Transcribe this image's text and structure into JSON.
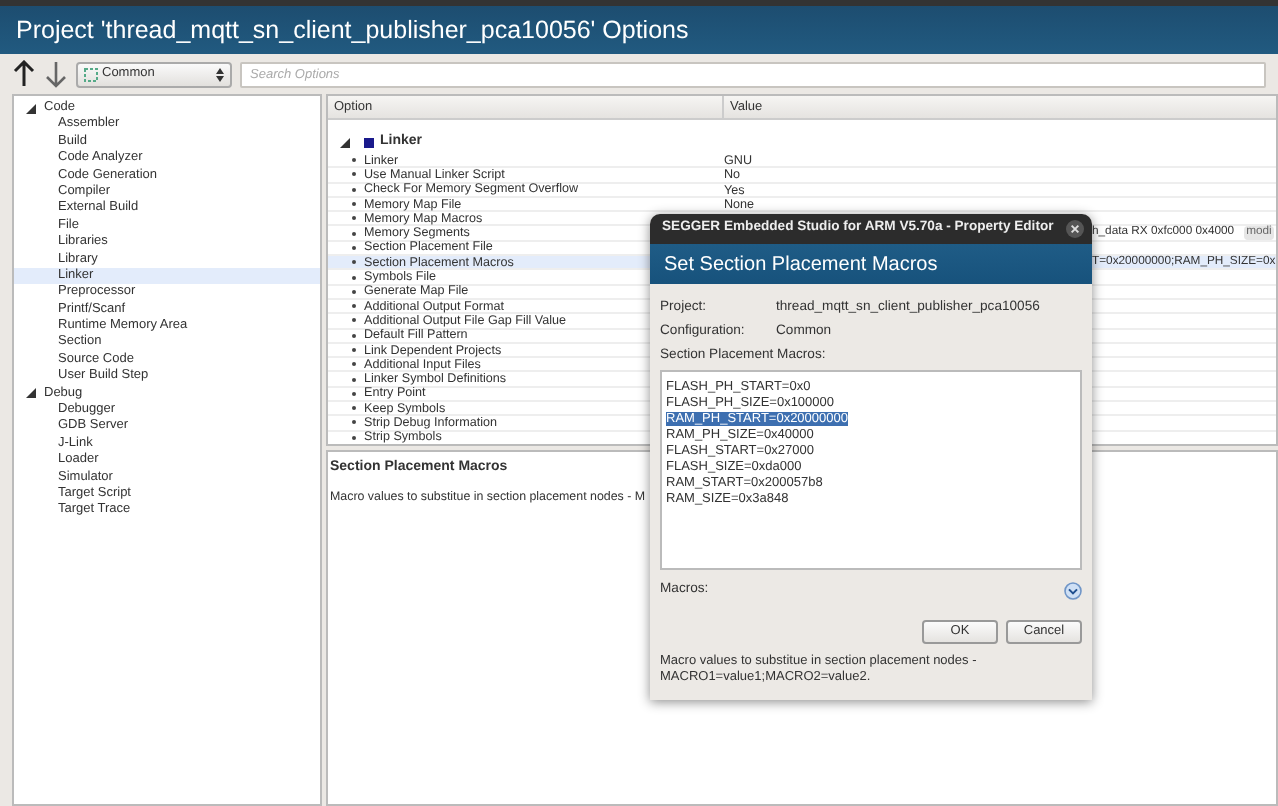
{
  "window": {
    "title": "Project 'thread_mqtt_sn_client_publisher_pca10056' Options"
  },
  "toolbar": {
    "configuration": "Common",
    "search": {
      "placeholder": "Search Options"
    }
  },
  "tree": [
    {
      "label": "Code",
      "expanded": true,
      "children": [
        {
          "label": "Assembler",
          "selected": false
        },
        {
          "label": "Build",
          "selected": false
        },
        {
          "label": "Code Analyzer",
          "selected": false
        },
        {
          "label": "Code Generation",
          "selected": false
        },
        {
          "label": "Compiler",
          "selected": false
        },
        {
          "label": "External Build",
          "selected": false
        },
        {
          "label": "File",
          "selected": false
        },
        {
          "label": "Libraries",
          "selected": false
        },
        {
          "label": "Library",
          "selected": false
        },
        {
          "label": "Linker",
          "selected": true
        },
        {
          "label": "Preprocessor",
          "selected": false
        },
        {
          "label": "Printf/Scanf",
          "selected": false
        },
        {
          "label": "Runtime Memory Area",
          "selected": false
        },
        {
          "label": "Section",
          "selected": false
        },
        {
          "label": "Source Code",
          "selected": false
        },
        {
          "label": "User Build Step",
          "selected": false
        }
      ]
    },
    {
      "label": "Debug",
      "expanded": true,
      "children": [
        {
          "label": "Debugger",
          "selected": false
        },
        {
          "label": "GDB Server",
          "selected": false
        },
        {
          "label": "J-Link",
          "selected": false
        },
        {
          "label": "Loader",
          "selected": false
        },
        {
          "label": "Simulator",
          "selected": false
        },
        {
          "label": "Target Script",
          "selected": false
        },
        {
          "label": "Target Trace",
          "selected": false
        }
      ]
    }
  ],
  "options_table": {
    "columns": [
      "Option",
      "Value"
    ],
    "group": {
      "label": "Linker",
      "expanded": true
    },
    "rows": [
      {
        "option": "Linker",
        "value": "GNU",
        "selected": false
      },
      {
        "option": "Use Manual Linker Script",
        "value": "No",
        "selected": false
      },
      {
        "option": "Check For Memory Segment Overflow",
        "value": "Yes",
        "selected": false
      },
      {
        "option": "Memory Map File",
        "value": "None",
        "selected": false
      },
      {
        "option": "Memory Map Macros",
        "selected": false
      },
      {
        "option": "Memory Segments",
        "value_tail": "h_data RX 0xfc000 0x4000",
        "tag": "modi",
        "selected": false
      },
      {
        "option": "Section Placement File",
        "selected": false
      },
      {
        "option": "Section Placement Macros",
        "value_tail": "T=0x20000000;RAM_PH_SIZE=0x",
        "selected": true
      },
      {
        "option": "Symbols File",
        "selected": false
      },
      {
        "option": "Generate Map File",
        "selected": false
      },
      {
        "option": "Additional Output Format",
        "selected": false
      },
      {
        "option": "Additional Output File Gap Fill Value",
        "selected": false
      },
      {
        "option": "Default Fill Pattern",
        "selected": false
      },
      {
        "option": "Link Dependent Projects",
        "selected": false
      },
      {
        "option": "Additional Input Files",
        "selected": false
      },
      {
        "option": "Linker Symbol Definitions",
        "selected": false
      },
      {
        "option": "Entry Point",
        "selected": false
      },
      {
        "option": "Keep Symbols",
        "selected": false
      },
      {
        "option": "Strip Debug Information",
        "selected": false
      },
      {
        "option": "Strip Symbols",
        "selected": false
      }
    ]
  },
  "description": {
    "title": "Section Placement Macros",
    "text": "Macro values to substitue in section placement nodes - M"
  },
  "dialog": {
    "title": "SEGGER Embedded Studio for ARM V5.70a - Property Editor",
    "heading": "Set Section Placement Macros",
    "fields": [
      {
        "label": "Project:",
        "value": "thread_mqtt_sn_client_publisher_pca10056"
      },
      {
        "label": "Configuration:",
        "value": "Common"
      }
    ],
    "list_label": "Section Placement Macros:",
    "lines": [
      {
        "text": "FLASH_PH_START=0x0",
        "selected": false
      },
      {
        "text": "FLASH_PH_SIZE=0x100000",
        "selected": false
      },
      {
        "text": "RAM_PH_START=0x20000000",
        "selected": true
      },
      {
        "text": "RAM_PH_SIZE=0x40000",
        "selected": false
      },
      {
        "text": "FLASH_START=0x27000",
        "selected": false
      },
      {
        "text": "FLASH_SIZE=0xda000",
        "selected": false
      },
      {
        "text": "RAM_START=0x200057b8",
        "selected": false
      },
      {
        "text": "RAM_SIZE=0x3a848",
        "selected": false
      }
    ],
    "macros_label": "Macros:",
    "buttons": [
      "OK",
      "Cancel"
    ],
    "note": "Macro values to substitue in section placement nodes - MACRO1=value1;MACRO2=value2."
  }
}
